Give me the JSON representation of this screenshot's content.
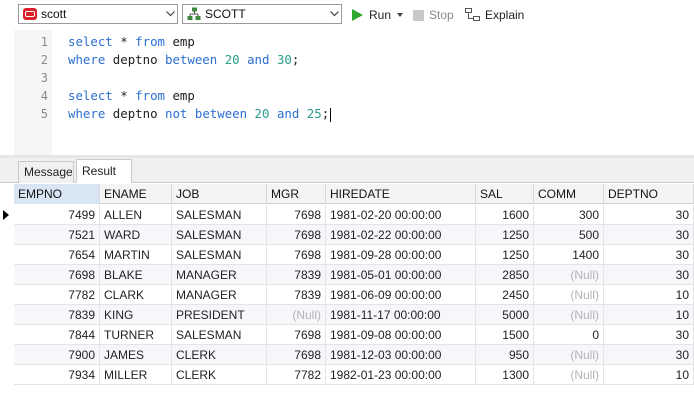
{
  "toolbar": {
    "connection": "scott",
    "schema": "SCOTT",
    "run_label": "Run",
    "stop_label": "Stop",
    "explain_label": "Explain"
  },
  "editor": {
    "lines": [
      {
        "num": "1",
        "tokens": [
          [
            "kw",
            "select"
          ],
          [
            "plain",
            " * "
          ],
          [
            "kw",
            "from"
          ],
          [
            "plain",
            " emp"
          ]
        ]
      },
      {
        "num": "2",
        "tokens": [
          [
            "kw",
            "where"
          ],
          [
            "plain",
            " deptno "
          ],
          [
            "kw",
            "between"
          ],
          [
            "plain",
            " "
          ],
          [
            "num",
            "20"
          ],
          [
            "plain",
            " "
          ],
          [
            "kw",
            "and"
          ],
          [
            "plain",
            " "
          ],
          [
            "num",
            "30"
          ],
          [
            "plain",
            ";"
          ]
        ]
      },
      {
        "num": "3",
        "tokens": []
      },
      {
        "num": "4",
        "tokens": [
          [
            "kw",
            "select"
          ],
          [
            "plain",
            " * "
          ],
          [
            "kw",
            "from"
          ],
          [
            "plain",
            " emp"
          ]
        ]
      },
      {
        "num": "5",
        "tokens": [
          [
            "kw",
            "where"
          ],
          [
            "plain",
            " deptno "
          ],
          [
            "kw",
            "not"
          ],
          [
            "plain",
            " "
          ],
          [
            "kw",
            "between"
          ],
          [
            "plain",
            " "
          ],
          [
            "num",
            "20"
          ],
          [
            "plain",
            " "
          ],
          [
            "kw",
            "and"
          ],
          [
            "plain",
            " "
          ],
          [
            "num",
            "25"
          ],
          [
            "plain",
            ";"
          ]
        ]
      }
    ]
  },
  "tabs": {
    "message": "Message",
    "result": "Result 1"
  },
  "grid": {
    "columns": [
      "EMPNO",
      "ENAME",
      "JOB",
      "MGR",
      "HIREDATE",
      "SAL",
      "COMM",
      "DEPTNO"
    ],
    "null_text": "(Null)",
    "rows": [
      [
        "7499",
        "ALLEN",
        "SALESMAN",
        "7698",
        "1981-02-20 00:00:00",
        "1600",
        "300",
        "30"
      ],
      [
        "7521",
        "WARD",
        "SALESMAN",
        "7698",
        "1981-02-22 00:00:00",
        "1250",
        "500",
        "30"
      ],
      [
        "7654",
        "MARTIN",
        "SALESMAN",
        "7698",
        "1981-09-28 00:00:00",
        "1250",
        "1400",
        "30"
      ],
      [
        "7698",
        "BLAKE",
        "MANAGER",
        "7839",
        "1981-05-01 00:00:00",
        "2850",
        "(Null)",
        "30"
      ],
      [
        "7782",
        "CLARK",
        "MANAGER",
        "7839",
        "1981-06-09 00:00:00",
        "2450",
        "(Null)",
        "10"
      ],
      [
        "7839",
        "KING",
        "PRESIDENT",
        "(Null)",
        "1981-11-17 00:00:00",
        "5000",
        "(Null)",
        "10"
      ],
      [
        "7844",
        "TURNER",
        "SALESMAN",
        "7698",
        "1981-09-08 00:00:00",
        "1500",
        "0",
        "30"
      ],
      [
        "7900",
        "JAMES",
        "CLERK",
        "7698",
        "1981-12-03 00:00:00",
        "950",
        "(Null)",
        "30"
      ],
      [
        "7934",
        "MILLER",
        "CLERK",
        "7782",
        "1982-01-23 00:00:00",
        "1300",
        "(Null)",
        "10"
      ]
    ]
  }
}
